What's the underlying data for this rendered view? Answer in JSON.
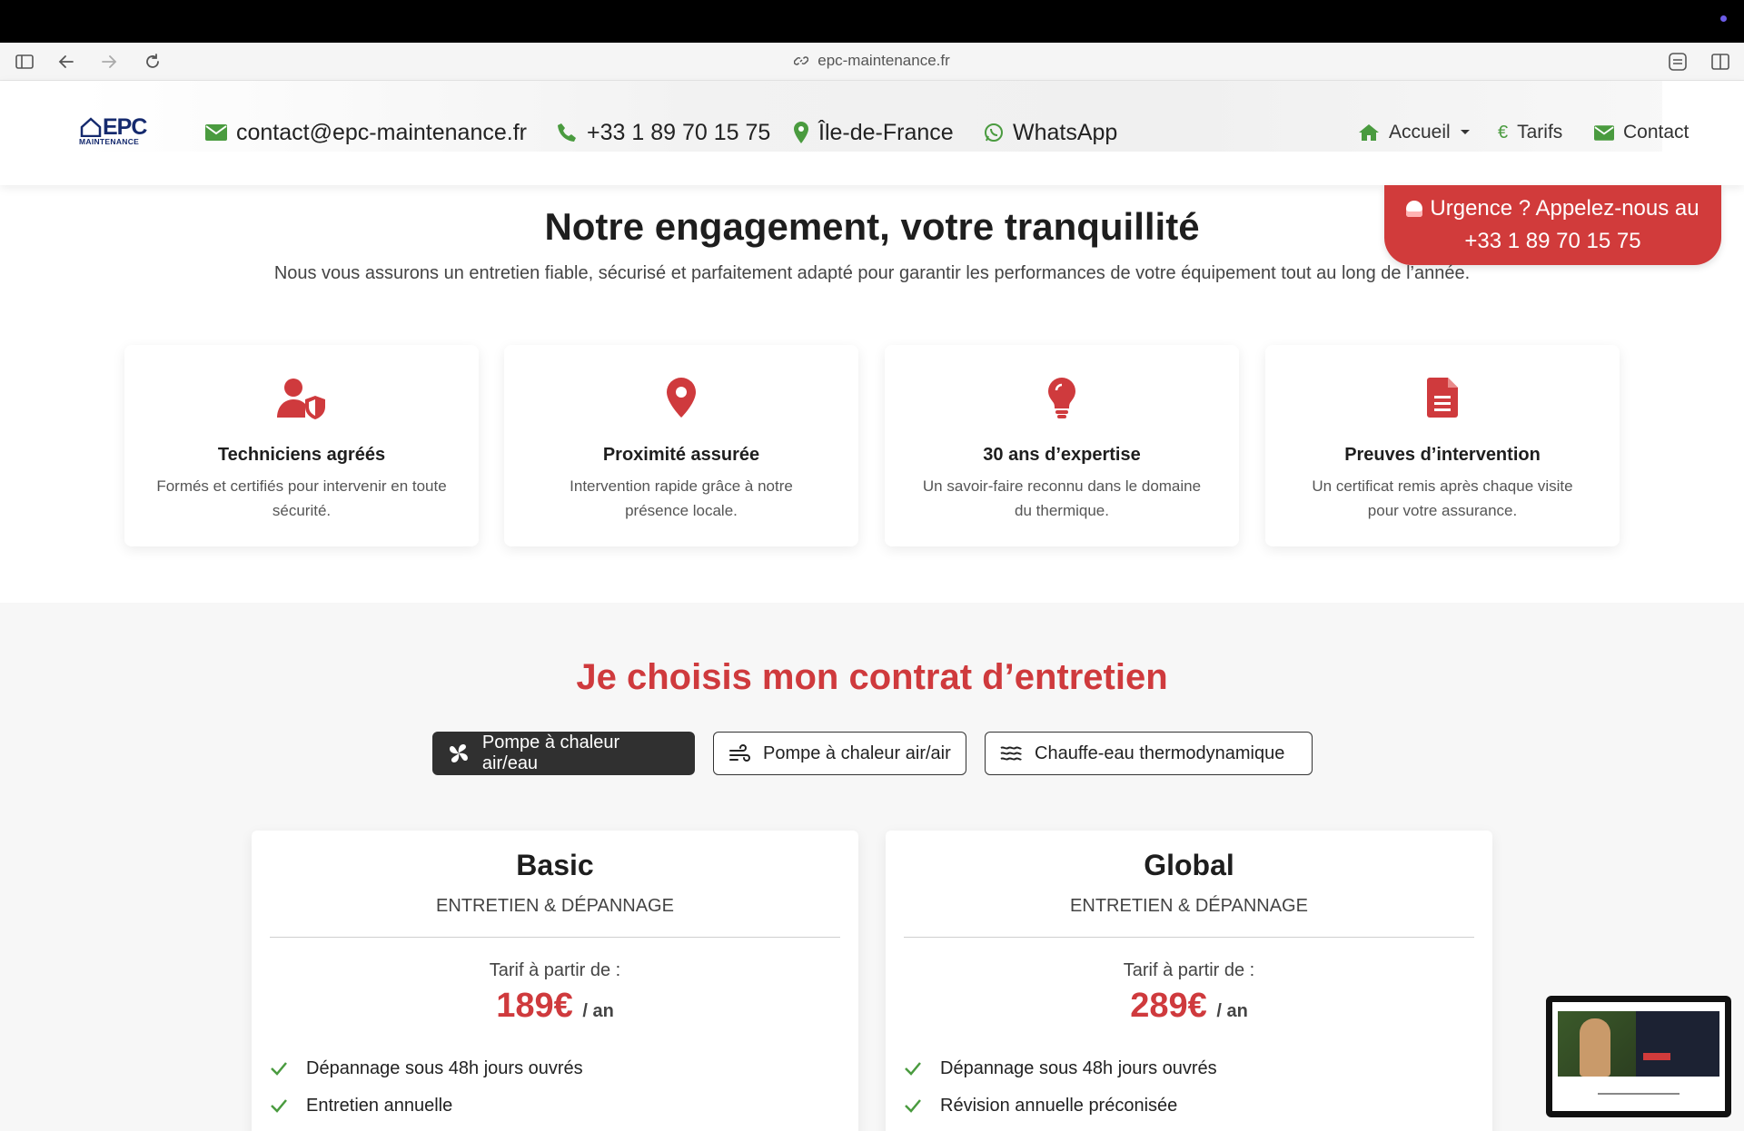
{
  "browser": {
    "url": "epc-maintenance.fr",
    "icons": [
      "sidebar-toggle-icon",
      "back-icon",
      "forward-icon",
      "reload-icon",
      "link-icon",
      "extensions-icon",
      "split-view-icon"
    ]
  },
  "header": {
    "logo_text": "EPC",
    "logo_subtext": "MAINTENANCE",
    "email": "contact@epc-maintenance.fr",
    "phone": "+33 1 89 70 15 75",
    "region": "Île-de-France",
    "whatsapp": "WhatsApp",
    "nav": {
      "home": "Accueil",
      "pricing": "Tarifs",
      "contact": "Contact"
    },
    "accent_green": "#4a9b3f"
  },
  "urgent": {
    "line1": "Urgence ? Appelez-nous au",
    "line2": "+33 1 89 70 15 75",
    "color": "#d13b3b"
  },
  "engagement": {
    "title": "Notre engagement, votre tranquillité",
    "subtitle": "Nous vous assurons un entretien fiable, sécurisé et parfaitement adapté pour garantir les performances de votre équipement tout au long de l’année.",
    "cards": [
      {
        "icon": "user-shield-icon",
        "title": "Techniciens agréés",
        "text": "Formés et certifiés pour intervenir en toute sécurité."
      },
      {
        "icon": "location-pin-icon",
        "title": "Proximité assurée",
        "text": "Intervention rapide grâce à notre présence locale."
      },
      {
        "icon": "lightbulb-icon",
        "title": "30 ans d’expertise",
        "text": "Un savoir-faire reconnu dans le domaine du thermique."
      },
      {
        "icon": "document-icon",
        "title": "Preuves d’intervention",
        "text": "Un certificat remis après chaque visite pour votre assurance."
      }
    ],
    "accent_red": "#cf3a3d"
  },
  "contracts": {
    "title": "Je choisis mon contrat d’entretien",
    "tabs": [
      {
        "label": "Pompe à chaleur air/eau",
        "icon": "fan-icon",
        "active": true
      },
      {
        "label": "Pompe à chaleur air/air",
        "icon": "wind-icon",
        "active": false
      },
      {
        "label": "Chauffe-eau thermodynamique",
        "icon": "water-waves-icon",
        "active": false
      }
    ],
    "plans": [
      {
        "name": "Basic",
        "subtitle": "ENTRETIEN & DÉPANNAGE",
        "from_label": "Tarif à partir de :",
        "price": "189€",
        "period": "/ an",
        "features": [
          "Dépannage sous 48h jours ouvrés",
          "Entretien annuelle"
        ]
      },
      {
        "name": "Global",
        "subtitle": "ENTRETIEN & DÉPANNAGE",
        "from_label": "Tarif à partir de :",
        "price": "289€",
        "period": "/ an",
        "features": [
          "Dépannage sous 48h jours ouvrés",
          "Révision annuelle préconisée"
        ]
      }
    ]
  }
}
